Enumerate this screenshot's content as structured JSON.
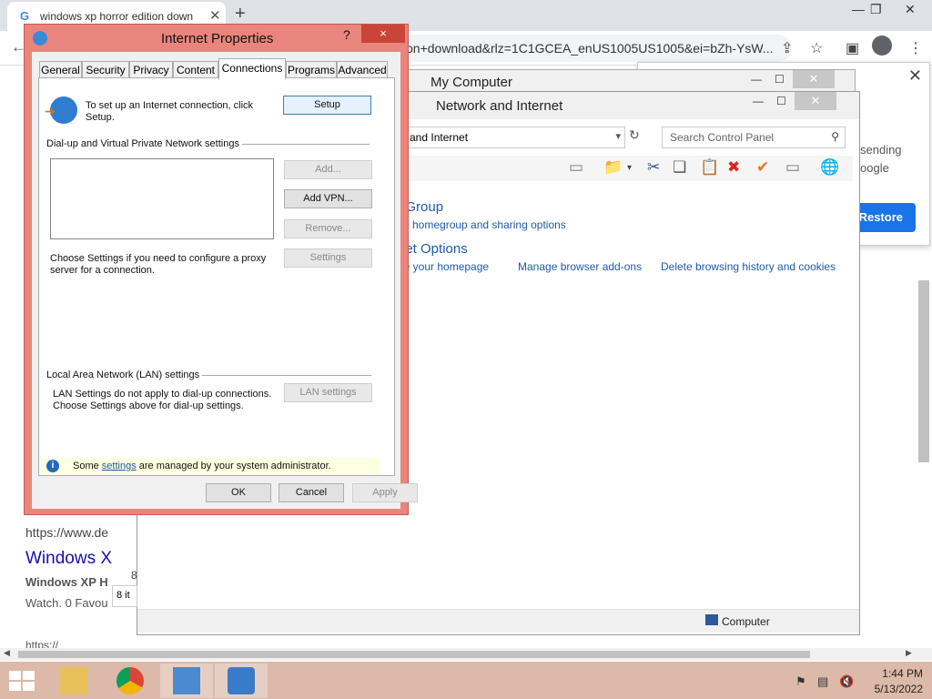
{
  "browser": {
    "tab_title": "windows xp horror edition down",
    "tab_icon": "G",
    "new_tab": "+",
    "url": "on+download&rlz=1C1GCEA_enUS1005US1005&ei=bZh-YsW...",
    "popup": {
      "text1": "sending",
      "text2": "oogle",
      "restore_label": "Restore"
    },
    "results": {
      "url_line": "https://www.de",
      "title": "Windows X",
      "bold_line": "Windows XP H",
      "snippet": "Watch. 0 Favou",
      "cut_line": "8",
      "bottom_url": "https://"
    }
  },
  "my_computer": {
    "title": "My Computer"
  },
  "control_panel": {
    "title": "Network and Internet",
    "address": "and Internet",
    "search_placeholder": "Search Control Panel",
    "homegroup_title": "eGroup",
    "homegroup_link": "se homegroup and sharing options",
    "internet_options_title": "net Options",
    "link_homepage": "ge your homepage",
    "link_addons": "Manage browser add-ons",
    "link_history": "Delete browsing history and cookies",
    "status_computer": "Computer",
    "items_count": "8 it"
  },
  "dialog": {
    "title": "Internet Properties",
    "help": "?",
    "close": "×",
    "tabs": [
      "General",
      "Security",
      "Privacy",
      "Content",
      "Connections",
      "Programs",
      "Advanced"
    ],
    "active_tab": "Connections",
    "setup_text_1": "To set up an Internet connection, click",
    "setup_text_2": "Setup.",
    "setup_button": "Setup",
    "dialup_header": "Dial-up and Virtual Private Network settings",
    "add_button": "Add...",
    "add_vpn_button": "Add VPN...",
    "remove_button": "Remove...",
    "settings_button": "Settings",
    "proxy_text_1": "Choose Settings if you need to configure a proxy",
    "proxy_text_2": "server for a connection.",
    "lan_header": "Local Area Network (LAN) settings",
    "lan_text_1": "LAN Settings do not apply to dial-up connections.",
    "lan_text_2": "Choose Settings above for dial-up settings.",
    "lan_button": "LAN settings",
    "info_prefix": "Some ",
    "info_link": "settings",
    "info_suffix": " are managed by your system administrator.",
    "ok": "OK",
    "cancel": "Cancel",
    "apply": "Apply"
  },
  "taskbar": {
    "time": "1:44 PM",
    "date": "5/13/2022"
  },
  "colors": {
    "dialog_frame": "#e9857c",
    "close_red": "#c94537",
    "link_blue": "#1e5aa8",
    "taskbar": "#dcb9a8",
    "restore_blue": "#1a73e8"
  }
}
